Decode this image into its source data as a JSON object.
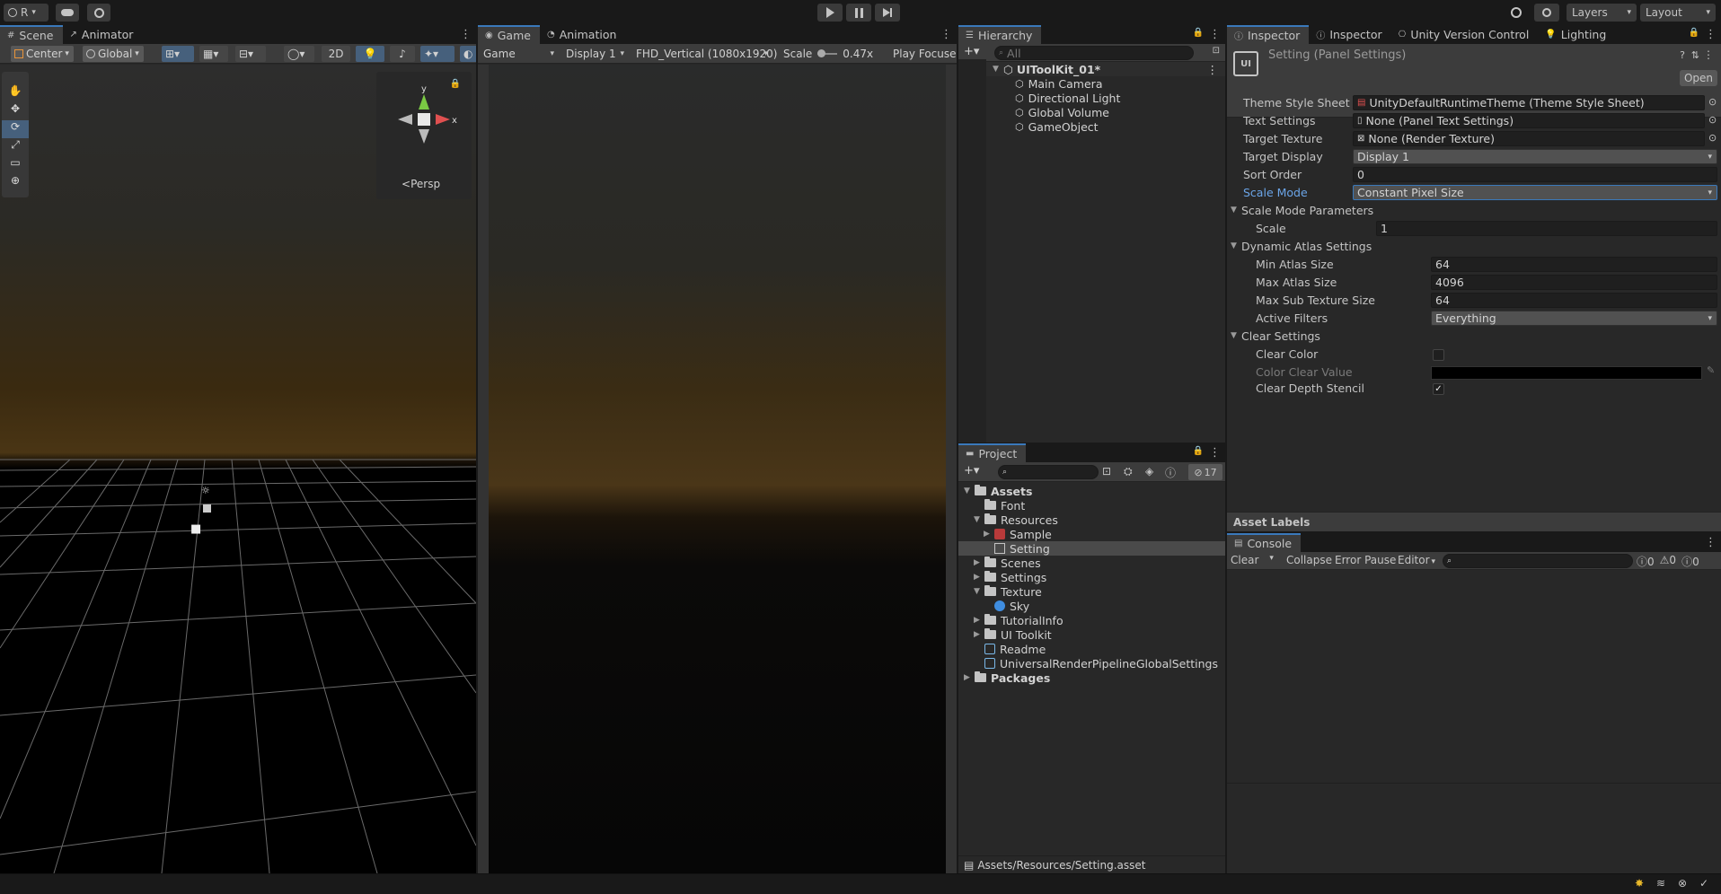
{
  "toolbar": {
    "account_label": "R",
    "layers_label": "Layers",
    "layout_label": "Layout"
  },
  "scene": {
    "tabs": [
      "Scene",
      "Animator"
    ],
    "pivot_label": "Center",
    "space_label": "Global",
    "mode_2d_label": "2D",
    "gizmo_y": "y",
    "gizmo_x": "x",
    "persp_label": "Persp"
  },
  "game": {
    "tabs": [
      "Game",
      "Animation"
    ],
    "display_type": "Game",
    "display": "Display 1",
    "resolution": "FHD_Vertical (1080x1920)",
    "scale_label": "Scale",
    "scale_value": "0.47x",
    "play_focused": "Play Focused"
  },
  "hierarchy": {
    "tab": "Hierarchy",
    "search_placeholder": "All",
    "scene_name": "UIToolKit_01*",
    "items": [
      "Main Camera",
      "Directional Light",
      "Global Volume",
      "GameObject"
    ]
  },
  "project": {
    "tab": "Project",
    "hidden_count": "17",
    "tree": [
      {
        "label": "Assets",
        "depth": 0,
        "expanded": true,
        "bold": true,
        "type": "folder-open"
      },
      {
        "label": "Font",
        "depth": 1,
        "expanded": false,
        "type": "folder"
      },
      {
        "label": "Resources",
        "depth": 1,
        "expanded": true,
        "type": "folder-open",
        "arrow": true
      },
      {
        "label": "Sample",
        "depth": 2,
        "type": "uxml",
        "arrow": true
      },
      {
        "label": "Setting",
        "depth": 2,
        "type": "asset",
        "selected": true
      },
      {
        "label": "Scenes",
        "depth": 1,
        "type": "folder",
        "arrow": true
      },
      {
        "label": "Settings",
        "depth": 1,
        "type": "folder",
        "arrow": true
      },
      {
        "label": "Texture",
        "depth": 1,
        "expanded": true,
        "type": "folder-open",
        "arrow": true
      },
      {
        "label": "Sky",
        "depth": 2,
        "type": "texture"
      },
      {
        "label": "TutorialInfo",
        "depth": 1,
        "type": "folder",
        "arrow": true
      },
      {
        "label": "UI Toolkit",
        "depth": 1,
        "type": "folder",
        "arrow": true
      },
      {
        "label": "Readme",
        "depth": 1,
        "type": "script"
      },
      {
        "label": "UniversalRenderPipelineGlobalSettings",
        "depth": 1,
        "type": "script"
      },
      {
        "label": "Packages",
        "depth": 0,
        "type": "folder",
        "bold": true,
        "arrow": true
      }
    ],
    "path": "Assets/Resources/Setting.asset"
  },
  "inspector": {
    "tabs": [
      "Inspector",
      "Inspector",
      "Unity Version Control",
      "Lighting"
    ],
    "title": "Setting (Panel Settings)",
    "open_label": "Open",
    "theme_style_sheet_label": "Theme Style Sheet",
    "theme_style_sheet_value": "UnityDefaultRuntimeTheme (Theme Style Sheet)",
    "text_settings_label": "Text Settings",
    "text_settings_value": "None (Panel Text Settings)",
    "target_texture_label": "Target Texture",
    "target_texture_value": "None (Render Texture)",
    "target_display_label": "Target Display",
    "target_display_value": "Display 1",
    "sort_order_label": "Sort Order",
    "sort_order_value": "0",
    "scale_mode_label": "Scale Mode",
    "scale_mode_value": "Constant Pixel Size",
    "scale_mode_params_label": "Scale Mode Parameters",
    "scale_label": "Scale",
    "scale_value": "1",
    "dynamic_atlas_label": "Dynamic Atlas Settings",
    "min_atlas_label": "Min Atlas Size",
    "min_atlas_value": "64",
    "max_atlas_label": "Max Atlas Size",
    "max_atlas_value": "4096",
    "max_sub_label": "Max Sub Texture Size",
    "max_sub_value": "64",
    "active_filters_label": "Active Filters",
    "active_filters_value": "Everything",
    "clear_settings_label": "Clear Settings",
    "clear_color_label": "Clear Color",
    "clear_color_checked": false,
    "color_clear_value_label": "Color Clear Value",
    "clear_depth_label": "Clear Depth Stencil",
    "clear_depth_checked": true,
    "asset_labels": "Asset Labels"
  },
  "console": {
    "tab": "Console",
    "clear_label": "Clear",
    "collapse_label": "Collapse",
    "error_pause_label": "Error Pause",
    "editor_label": "Editor",
    "log_count": "0",
    "warn_count": "0",
    "error_count": "0"
  },
  "colors": {
    "accent_blue": "#3a79bb",
    "selection": "#2c5d87",
    "scale_mode_label": "#6ba5e8"
  }
}
